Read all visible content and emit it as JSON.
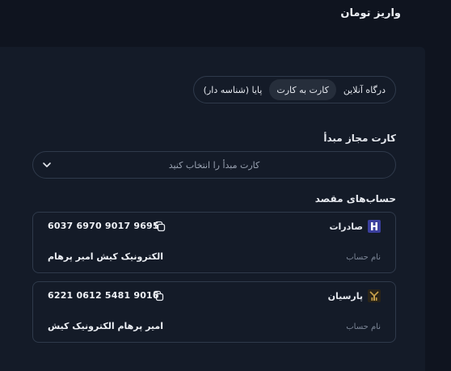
{
  "page": {
    "title": "واریز تومان"
  },
  "methods": [
    {
      "label": "درگاه آنلاین",
      "active": false
    },
    {
      "label": "کارت به کارت",
      "active": true
    },
    {
      "label": "پایا (شناسه دار)",
      "active": false
    }
  ],
  "source_card": {
    "label": "کارت مجاز مبدأ",
    "placeholder": "کارت مبدأ را انتخاب کنید"
  },
  "destinations": {
    "label": "حساب‌های مقصد",
    "accounts": [
      {
        "bank": "صادرات",
        "bank_logo": "saderat-logo-icon",
        "card_number": "6037 6970 9017 9695",
        "holder_label": "نام حساب",
        "holder_name": "الکترونیک کیش امیر پرهام"
      },
      {
        "bank": "پارسیان",
        "bank_logo": "parsian-logo-icon",
        "card_number": "6221 0612 5481 9016",
        "holder_label": "نام حساب",
        "holder_name": "امیر پرهام الکترونیک کیش"
      }
    ]
  },
  "colors": {
    "background": "#0f141f",
    "panel": "#141b28",
    "border": "#2f3a4b",
    "active_segment": "#262e3b",
    "saderat_blue": "#3b3f9e",
    "parsian_gold": "#c9a24a"
  }
}
